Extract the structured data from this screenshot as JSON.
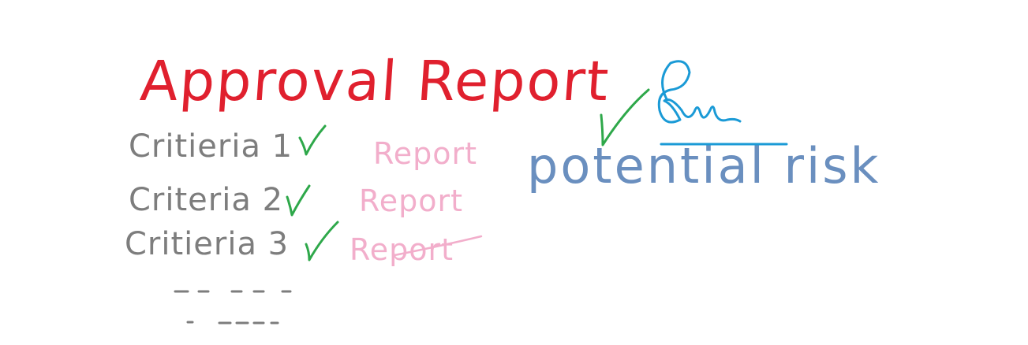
{
  "title": "Approval Report",
  "criteria": [
    {
      "label": "Critieria 1",
      "report": "Report"
    },
    {
      "label": "Criteria 2",
      "report": "Report"
    },
    {
      "label": "Critieria 3",
      "report": "Report"
    }
  ],
  "risk_label": "potential risk",
  "colors": {
    "title": "#e0202e",
    "criteria": "#7d7d7d",
    "report": "#f2aecb",
    "check": "#2ea84a",
    "risk": "#6a8fbf",
    "signature": "#1a9ad6",
    "dashes": "#7d7d7d"
  }
}
